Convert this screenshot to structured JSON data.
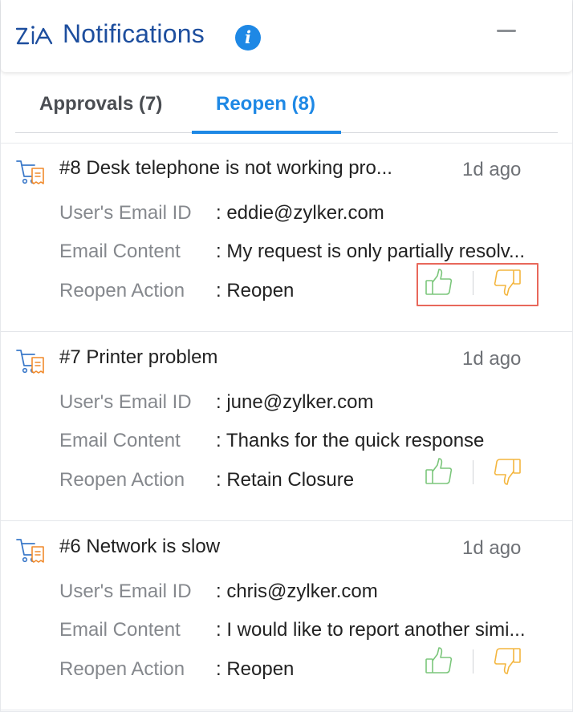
{
  "header": {
    "title": "Notifications"
  },
  "tabs": [
    {
      "label": "Approvals (7)",
      "active": false
    },
    {
      "label": "Reopen (8)",
      "active": true
    }
  ],
  "field_labels": {
    "email": "User's Email ID",
    "content": "Email Content",
    "action": "Reopen Action"
  },
  "notifications": [
    {
      "title": "#8 Desk telephone is not working pro...",
      "age": "1d ago",
      "email": ": eddie@zylker.com",
      "content": ": My request is only partially resolv...",
      "action": ": Reopen",
      "highlighted": true
    },
    {
      "title": "#7 Printer problem",
      "age": "1d ago",
      "email": ": june@zylker.com",
      "content": ": Thanks for the quick response",
      "action": ": Retain Closure",
      "highlighted": false
    },
    {
      "title": "#6 Network is slow",
      "age": "1d ago",
      "email": ": chris@zylker.com",
      "content": ": I would like to report another simi...",
      "action": ": Reopen",
      "highlighted": false
    }
  ],
  "colors": {
    "brand": "#1d4e9e",
    "accent": "#1e88e5",
    "approve": "#7bc67b",
    "reject": "#f4b63f",
    "highlight": "#e8685b"
  },
  "icons": {
    "logo": "zia-logo-icon",
    "info": "info-icon",
    "minimize": "minimize-icon",
    "item": "cart-ticket-icon",
    "approve": "thumbs-up-icon",
    "reject": "thumbs-down-icon"
  }
}
